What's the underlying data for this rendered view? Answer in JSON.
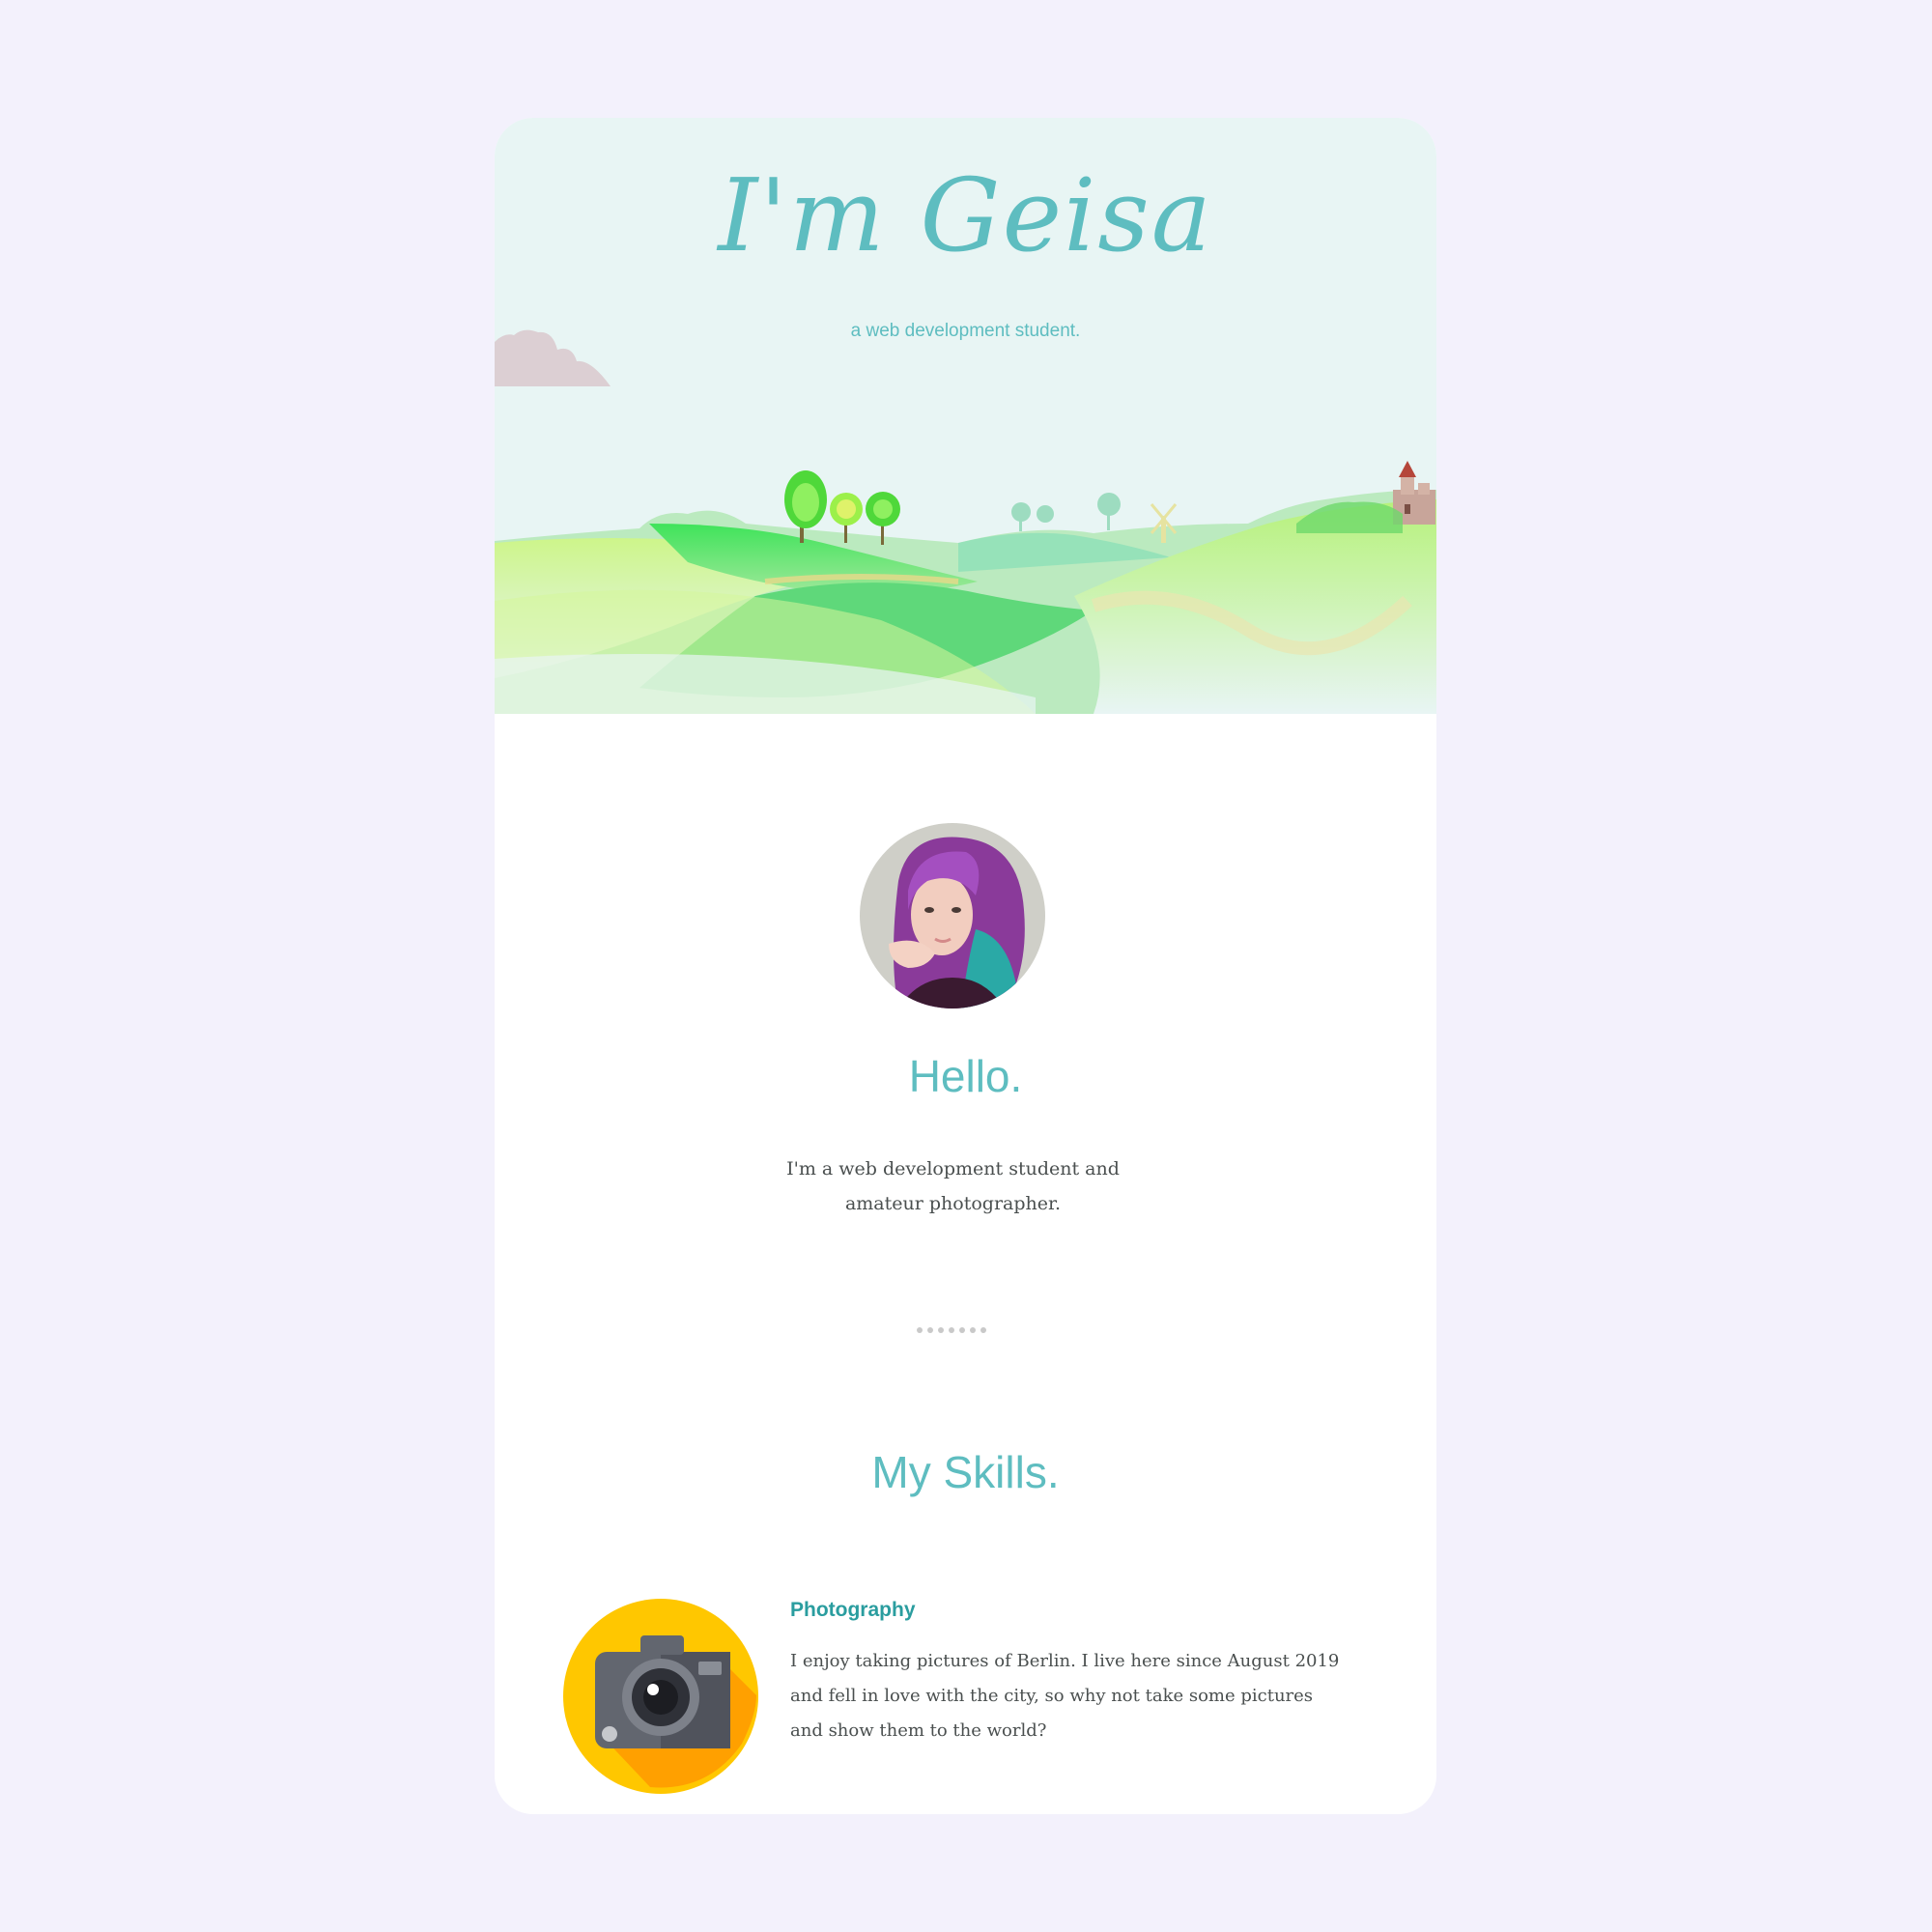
{
  "hero": {
    "title": "I'm Geisa",
    "subtitle": "a web development student."
  },
  "about": {
    "heading": "Hello.",
    "text": "I'm a web development student and amateur photographer."
  },
  "skills": {
    "heading": "My Skills.",
    "items": [
      {
        "name": "Photography",
        "icon": "camera-icon",
        "description": "I enjoy taking pictures of Berlin. I live here since August 2019 and fell in love with the city, so why not take some pictures and show them to the world?"
      }
    ]
  },
  "colors": {
    "page_background": "#f3f1fc",
    "accent": "#5ebdc0",
    "hero_background": "#e8f5f4",
    "body_text": "#4a4f4f"
  }
}
